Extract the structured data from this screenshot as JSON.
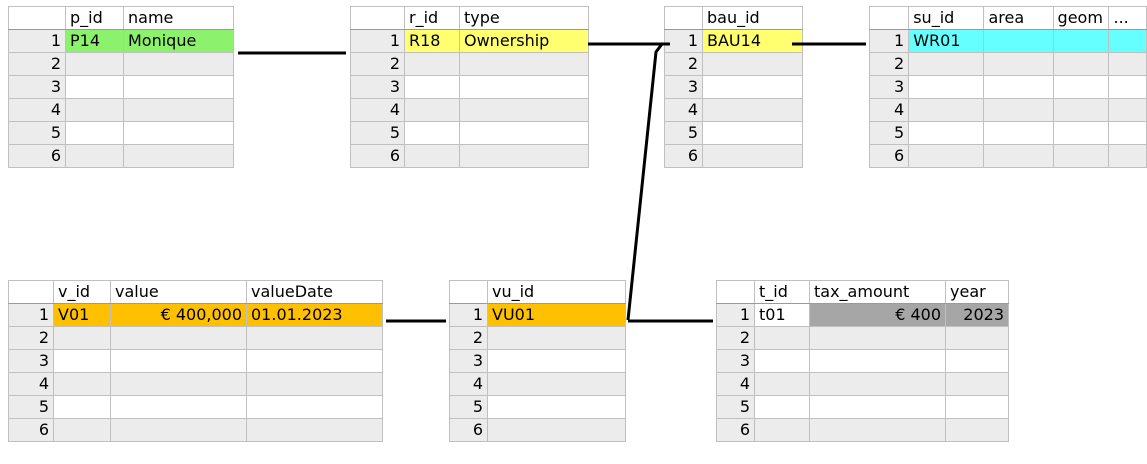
{
  "tables": {
    "party": {
      "columns": [
        "p_id",
        "name"
      ],
      "row_numbers": [
        "1",
        "2",
        "3",
        "4",
        "5",
        "6"
      ],
      "rows": [
        [
          "P14",
          "Monique"
        ]
      ],
      "fill": "#8cf26e"
    },
    "rrr": {
      "columns": [
        "r_id",
        "type"
      ],
      "row_numbers": [
        "1",
        "2",
        "3",
        "4",
        "5",
        "6"
      ],
      "rows": [
        [
          "R18",
          "Ownership"
        ]
      ],
      "fill": "#ffff70"
    },
    "baunit": {
      "columns": [
        "bau_id"
      ],
      "row_numbers": [
        "1",
        "2",
        "3",
        "4",
        "5",
        "6"
      ],
      "rows": [
        [
          "BAU14"
        ]
      ],
      "fill": "#ffff70"
    },
    "spatial_unit": {
      "columns": [
        "su_id",
        "area",
        "geom",
        "..."
      ],
      "row_numbers": [
        "1",
        "2",
        "3",
        "4",
        "5",
        "6"
      ],
      "rows": [
        [
          "WR01",
          "",
          "",
          ""
        ]
      ],
      "fill": "#66ffff"
    },
    "valuation": {
      "columns": [
        "v_id",
        "value",
        "valueDate"
      ],
      "row_numbers": [
        "1",
        "2",
        "3",
        "4",
        "5",
        "6"
      ],
      "rows": [
        [
          "V01",
          "€ 400,000",
          "01.01.2023"
        ]
      ],
      "fill": "#ffc000"
    },
    "valuation_unit": {
      "columns": [
        "vu_id"
      ],
      "row_numbers": [
        "1",
        "2",
        "3",
        "4",
        "5",
        "6"
      ],
      "rows": [
        [
          "VU01"
        ]
      ],
      "fill": "#ffc000"
    },
    "tax": {
      "columns": [
        "t_id",
        "tax_amount",
        "year"
      ],
      "row_numbers": [
        "1",
        "2",
        "3",
        "4",
        "5",
        "6"
      ],
      "rows": [
        [
          "t01",
          "€ 400",
          "2023"
        ]
      ],
      "fill": "#a6a6a6"
    }
  },
  "connector_color": "#000000"
}
